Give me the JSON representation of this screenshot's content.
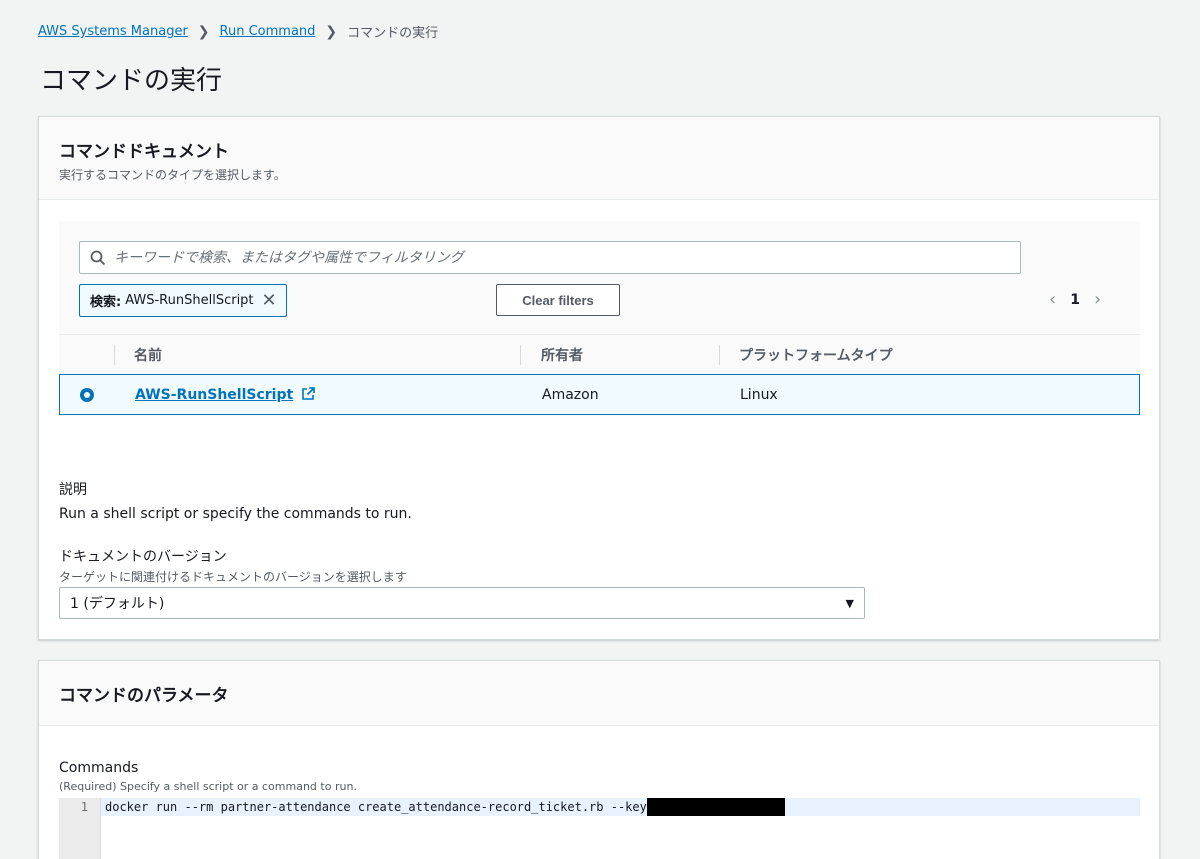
{
  "breadcrumb": {
    "item1": "AWS Systems Manager",
    "item2": "Run Command",
    "current": "コマンドの実行"
  },
  "page_title": "コマンドの実行",
  "document_panel": {
    "title": "コマンドドキュメント",
    "subtitle": "実行するコマンドのタイプを選択します。",
    "search_placeholder": "キーワードで検索、またはタグや属性でフィルタリング",
    "filter_token": {
      "key": "検索:",
      "value": "AWS-RunShellScript"
    },
    "clear_filters": "Clear filters",
    "page": "1",
    "columns": {
      "name": "名前",
      "owner": "所有者",
      "platform": "プラットフォームタイプ"
    },
    "row": {
      "name": "AWS-RunShellScript",
      "owner": "Amazon",
      "platform": "Linux",
      "selected": true
    },
    "description_label": "説明",
    "description": "Run a shell script or specify the commands to run.",
    "version_label": "ドキュメントのバージョン",
    "version_hint": "ターゲットに関連付けるドキュメントのバージョンを選択します",
    "version_value": "1 (デフォルト)"
  },
  "params_panel": {
    "title": "コマンドのパラメータ",
    "commands_label": "Commands",
    "commands_hint": "(Required) Specify a shell script or a command to run.",
    "line_number": "1",
    "command_text": "docker run --rm partner-attendance create_attendance-record_ticket.rb --key"
  },
  "colors": {
    "accent": "#0073bb",
    "background": "#f2f3f3"
  }
}
